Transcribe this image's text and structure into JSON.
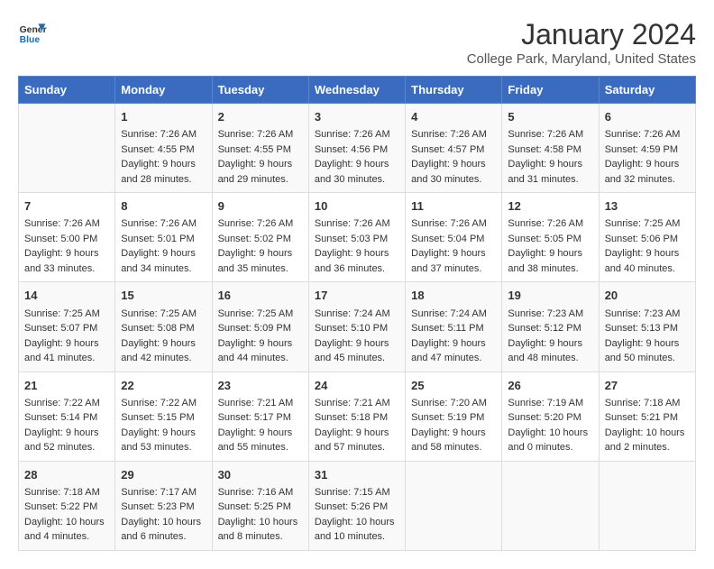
{
  "header": {
    "logo_line1": "General",
    "logo_line2": "Blue",
    "title": "January 2024",
    "subtitle": "College Park, Maryland, United States"
  },
  "calendar": {
    "days_of_week": [
      "Sunday",
      "Monday",
      "Tuesday",
      "Wednesday",
      "Thursday",
      "Friday",
      "Saturday"
    ],
    "weeks": [
      [
        {
          "day": "",
          "sunrise": "",
          "sunset": "",
          "daylight": ""
        },
        {
          "day": "1",
          "sunrise": "Sunrise: 7:26 AM",
          "sunset": "Sunset: 4:55 PM",
          "daylight": "Daylight: 9 hours and 28 minutes."
        },
        {
          "day": "2",
          "sunrise": "Sunrise: 7:26 AM",
          "sunset": "Sunset: 4:55 PM",
          "daylight": "Daylight: 9 hours and 29 minutes."
        },
        {
          "day": "3",
          "sunrise": "Sunrise: 7:26 AM",
          "sunset": "Sunset: 4:56 PM",
          "daylight": "Daylight: 9 hours and 30 minutes."
        },
        {
          "day": "4",
          "sunrise": "Sunrise: 7:26 AM",
          "sunset": "Sunset: 4:57 PM",
          "daylight": "Daylight: 9 hours and 30 minutes."
        },
        {
          "day": "5",
          "sunrise": "Sunrise: 7:26 AM",
          "sunset": "Sunset: 4:58 PM",
          "daylight": "Daylight: 9 hours and 31 minutes."
        },
        {
          "day": "6",
          "sunrise": "Sunrise: 7:26 AM",
          "sunset": "Sunset: 4:59 PM",
          "daylight": "Daylight: 9 hours and 32 minutes."
        }
      ],
      [
        {
          "day": "7",
          "sunrise": "Sunrise: 7:26 AM",
          "sunset": "Sunset: 5:00 PM",
          "daylight": "Daylight: 9 hours and 33 minutes."
        },
        {
          "day": "8",
          "sunrise": "Sunrise: 7:26 AM",
          "sunset": "Sunset: 5:01 PM",
          "daylight": "Daylight: 9 hours and 34 minutes."
        },
        {
          "day": "9",
          "sunrise": "Sunrise: 7:26 AM",
          "sunset": "Sunset: 5:02 PM",
          "daylight": "Daylight: 9 hours and 35 minutes."
        },
        {
          "day": "10",
          "sunrise": "Sunrise: 7:26 AM",
          "sunset": "Sunset: 5:03 PM",
          "daylight": "Daylight: 9 hours and 36 minutes."
        },
        {
          "day": "11",
          "sunrise": "Sunrise: 7:26 AM",
          "sunset": "Sunset: 5:04 PM",
          "daylight": "Daylight: 9 hours and 37 minutes."
        },
        {
          "day": "12",
          "sunrise": "Sunrise: 7:26 AM",
          "sunset": "Sunset: 5:05 PM",
          "daylight": "Daylight: 9 hours and 38 minutes."
        },
        {
          "day": "13",
          "sunrise": "Sunrise: 7:25 AM",
          "sunset": "Sunset: 5:06 PM",
          "daylight": "Daylight: 9 hours and 40 minutes."
        }
      ],
      [
        {
          "day": "14",
          "sunrise": "Sunrise: 7:25 AM",
          "sunset": "Sunset: 5:07 PM",
          "daylight": "Daylight: 9 hours and 41 minutes."
        },
        {
          "day": "15",
          "sunrise": "Sunrise: 7:25 AM",
          "sunset": "Sunset: 5:08 PM",
          "daylight": "Daylight: 9 hours and 42 minutes."
        },
        {
          "day": "16",
          "sunrise": "Sunrise: 7:25 AM",
          "sunset": "Sunset: 5:09 PM",
          "daylight": "Daylight: 9 hours and 44 minutes."
        },
        {
          "day": "17",
          "sunrise": "Sunrise: 7:24 AM",
          "sunset": "Sunset: 5:10 PM",
          "daylight": "Daylight: 9 hours and 45 minutes."
        },
        {
          "day": "18",
          "sunrise": "Sunrise: 7:24 AM",
          "sunset": "Sunset: 5:11 PM",
          "daylight": "Daylight: 9 hours and 47 minutes."
        },
        {
          "day": "19",
          "sunrise": "Sunrise: 7:23 AM",
          "sunset": "Sunset: 5:12 PM",
          "daylight": "Daylight: 9 hours and 48 minutes."
        },
        {
          "day": "20",
          "sunrise": "Sunrise: 7:23 AM",
          "sunset": "Sunset: 5:13 PM",
          "daylight": "Daylight: 9 hours and 50 minutes."
        }
      ],
      [
        {
          "day": "21",
          "sunrise": "Sunrise: 7:22 AM",
          "sunset": "Sunset: 5:14 PM",
          "daylight": "Daylight: 9 hours and 52 minutes."
        },
        {
          "day": "22",
          "sunrise": "Sunrise: 7:22 AM",
          "sunset": "Sunset: 5:15 PM",
          "daylight": "Daylight: 9 hours and 53 minutes."
        },
        {
          "day": "23",
          "sunrise": "Sunrise: 7:21 AM",
          "sunset": "Sunset: 5:17 PM",
          "daylight": "Daylight: 9 hours and 55 minutes."
        },
        {
          "day": "24",
          "sunrise": "Sunrise: 7:21 AM",
          "sunset": "Sunset: 5:18 PM",
          "daylight": "Daylight: 9 hours and 57 minutes."
        },
        {
          "day": "25",
          "sunrise": "Sunrise: 7:20 AM",
          "sunset": "Sunset: 5:19 PM",
          "daylight": "Daylight: 9 hours and 58 minutes."
        },
        {
          "day": "26",
          "sunrise": "Sunrise: 7:19 AM",
          "sunset": "Sunset: 5:20 PM",
          "daylight": "Daylight: 10 hours and 0 minutes."
        },
        {
          "day": "27",
          "sunrise": "Sunrise: 7:18 AM",
          "sunset": "Sunset: 5:21 PM",
          "daylight": "Daylight: 10 hours and 2 minutes."
        }
      ],
      [
        {
          "day": "28",
          "sunrise": "Sunrise: 7:18 AM",
          "sunset": "Sunset: 5:22 PM",
          "daylight": "Daylight: 10 hours and 4 minutes."
        },
        {
          "day": "29",
          "sunrise": "Sunrise: 7:17 AM",
          "sunset": "Sunset: 5:23 PM",
          "daylight": "Daylight: 10 hours and 6 minutes."
        },
        {
          "day": "30",
          "sunrise": "Sunrise: 7:16 AM",
          "sunset": "Sunset: 5:25 PM",
          "daylight": "Daylight: 10 hours and 8 minutes."
        },
        {
          "day": "31",
          "sunrise": "Sunrise: 7:15 AM",
          "sunset": "Sunset: 5:26 PM",
          "daylight": "Daylight: 10 hours and 10 minutes."
        },
        {
          "day": "",
          "sunrise": "",
          "sunset": "",
          "daylight": ""
        },
        {
          "day": "",
          "sunrise": "",
          "sunset": "",
          "daylight": ""
        },
        {
          "day": "",
          "sunrise": "",
          "sunset": "",
          "daylight": ""
        }
      ]
    ]
  }
}
